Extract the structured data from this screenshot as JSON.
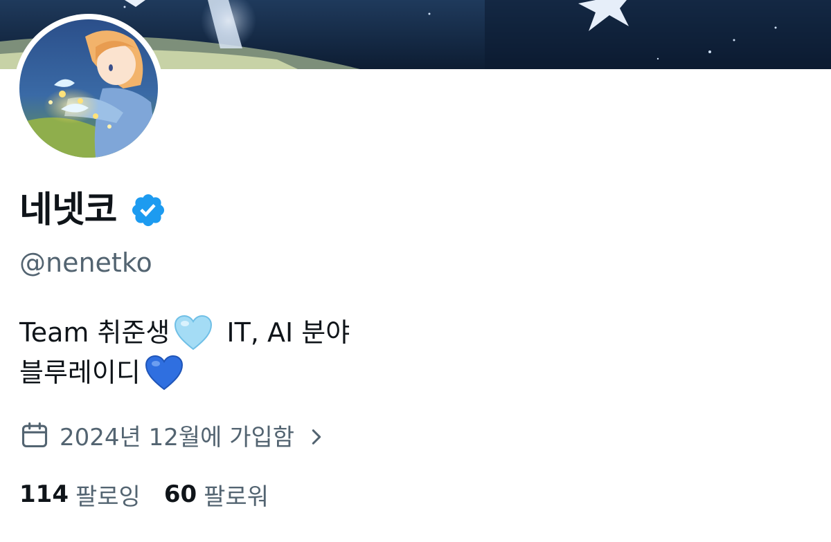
{
  "profile": {
    "display_name": "네넷코",
    "handle": "@nenetko",
    "bio_line1_text1": "Team 취준생",
    "bio_line1_text2": "IT, AI 분야",
    "bio_line2_text": "블루레이디",
    "joined_text": "2024년 12월에 가입함",
    "following_count": "114",
    "following_label": "팔로잉",
    "followers_count": "60",
    "followers_label": "팔로워"
  },
  "icons": {
    "verified": "verified-badge-icon",
    "light_blue_heart": "light-blue-heart-icon",
    "blue_heart": "blue-heart-icon",
    "calendar": "calendar-icon",
    "chevron": "chevron-right-icon"
  },
  "colors": {
    "text_primary": "#0f1419",
    "text_secondary": "#536471",
    "verified_blue": "#1d9bf0",
    "light_blue_heart": "#9ad9f5",
    "blue_heart": "#2f6fe0"
  }
}
